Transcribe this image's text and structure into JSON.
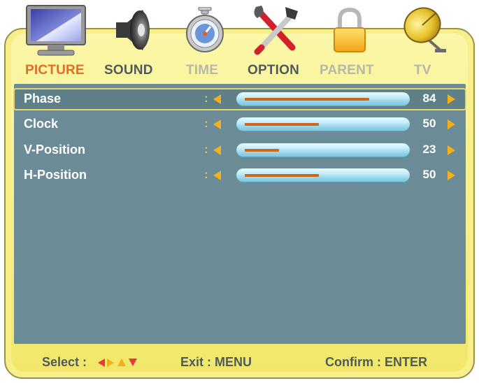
{
  "tabs": [
    {
      "label": "PICTURE",
      "state": "active",
      "icon": "monitor-icon"
    },
    {
      "label": "SOUND",
      "state": "normal",
      "icon": "speaker-icon"
    },
    {
      "label": "TIME",
      "state": "dim",
      "icon": "stopwatch-icon"
    },
    {
      "label": "OPTION",
      "state": "normal",
      "icon": "tools-icon"
    },
    {
      "label": "PARENT",
      "state": "dim",
      "icon": "lock-icon"
    },
    {
      "label": "TV",
      "state": "dim",
      "icon": "satellite-dish-icon"
    }
  ],
  "settings": [
    {
      "label": "Phase",
      "colon": ":",
      "value": "84",
      "level": 84,
      "max": 100,
      "selected": true
    },
    {
      "label": "Clock",
      "colon": ":",
      "value": "50",
      "level": 50,
      "max": 100,
      "selected": false
    },
    {
      "label": "V-Position",
      "colon": ":",
      "value": "23",
      "level": 23,
      "max": 100,
      "selected": false
    },
    {
      "label": "H-Position",
      "colon": ":",
      "value": "50",
      "level": 50,
      "max": 100,
      "selected": false
    }
  ],
  "footer": {
    "select_label": "Select :",
    "exit_label": "Exit : MENU",
    "confirm_label": "Confirm : ENTER"
  },
  "colors": {
    "frame": "#f7f08a",
    "panel": "#6b8c96",
    "active_tab": "#e86a24",
    "arrow": "#f3b01b",
    "slider_fill": "#d0661c",
    "arrow_red": "#e83a3a"
  }
}
